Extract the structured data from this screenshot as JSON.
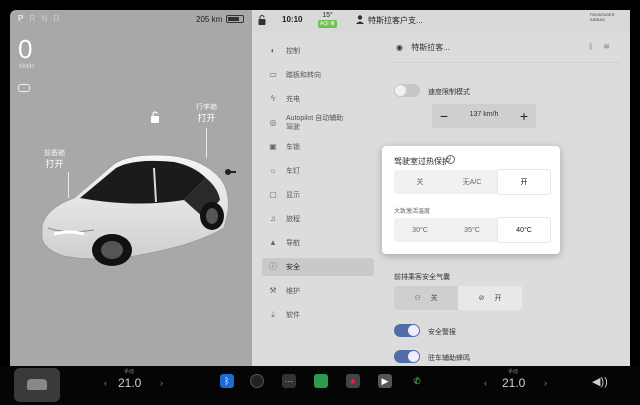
{
  "status": {
    "gear": [
      "P",
      "R",
      "N",
      "D"
    ],
    "active_gear": "P",
    "range": "205 km",
    "speed": "0",
    "speed_unit": "KM/H"
  },
  "car": {
    "trunk_label": "行李箱",
    "trunk_state": "打开",
    "frunk_label": "前备箱",
    "frunk_state": "打开"
  },
  "topbar": {
    "time": "10:10",
    "temp": "15°",
    "aqi": "AQI 良",
    "profile": "特斯拉客户支...",
    "airbag": "PASSENGER AIRBAG"
  },
  "nav": {
    "items": [
      {
        "label": "控制",
        "icon": "toggle-icon"
      },
      {
        "label": "踏板和转向",
        "icon": "car-icon"
      },
      {
        "label": "充电",
        "icon": "bolt-icon"
      },
      {
        "label": "Autopilot 自动辅助驾驶",
        "icon": "steering-icon"
      },
      {
        "label": "车锁",
        "icon": "lock-icon"
      },
      {
        "label": "车灯",
        "icon": "light-icon"
      },
      {
        "label": "显示",
        "icon": "display-icon"
      },
      {
        "label": "旅程",
        "icon": "trip-icon"
      },
      {
        "label": "导航",
        "icon": "nav-icon"
      },
      {
        "label": "安全",
        "icon": "shield-icon"
      },
      {
        "label": "维护",
        "icon": "wrench-icon"
      },
      {
        "label": "软件",
        "icon": "download-icon"
      }
    ],
    "active": "安全"
  },
  "main": {
    "user": "特斯拉客...",
    "speed_limit_label": "速度限制模式",
    "speed_limit_value": "137 km/h",
    "minus": "−",
    "plus": "+",
    "passenger_airbag_label": "前排乘客安全气囊",
    "airbag_off": "关",
    "airbag_on": "开",
    "security_alarm": "安全警报",
    "park_assist": "驻车辅助蜂鸣"
  },
  "popup": {
    "title": "驾驶室过热保护",
    "options": [
      "关",
      "无A/C",
      "开"
    ],
    "selected": "开",
    "temp_label": "大致激活温度",
    "temps": [
      "30°C",
      "35°C",
      "40°C"
    ],
    "temp_selected": "40°C"
  },
  "dock": {
    "driver_temp": "21.0",
    "passenger_temp": "21.0",
    "driver_label": "手动",
    "passenger_label": "手动"
  }
}
